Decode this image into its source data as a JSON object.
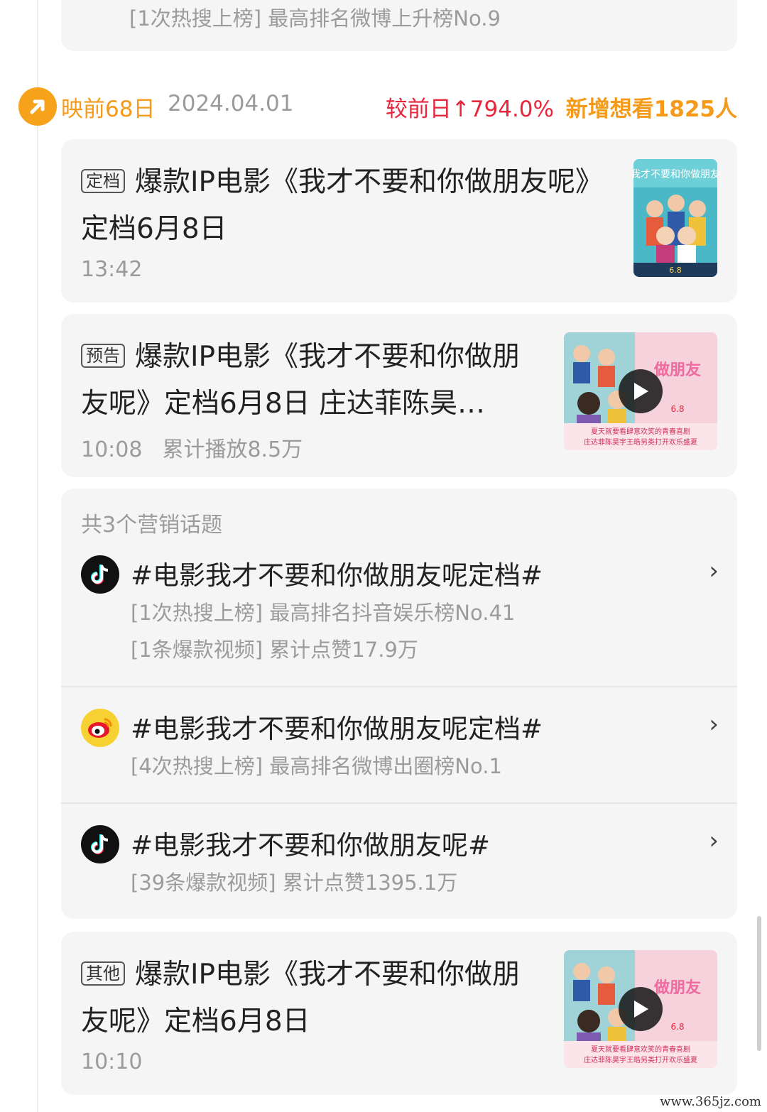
{
  "top_card": {
    "line": "[1次热搜上榜] 最高排名微博上升榜No.9"
  },
  "day": {
    "icon": "trend-arrow-icon",
    "label": "映前68日",
    "date": "2024.04.01",
    "change": "较前日↑794.0%",
    "added": "新增想看1825人"
  },
  "news": [
    {
      "tag": "定档",
      "title": "爆款IP电影《我才不要和你做朋友呢》定档6月8日",
      "time": "13:42",
      "stat": "",
      "thumb_type": "poster"
    },
    {
      "tag": "预告",
      "title": "爆款IP电影《我才不要和你做朋友呢》定档6月8日 庄达菲陈昊…",
      "time": "10:08",
      "stat": "累计播放8.5万",
      "thumb_type": "video"
    },
    {
      "tag": "其他",
      "title": "爆款IP电影《我才不要和你做朋友呢》定档6月8日",
      "time": "10:10",
      "stat": "",
      "thumb_type": "video"
    }
  ],
  "topics": {
    "header": "共3个营销话题",
    "items": [
      {
        "platform": "tiktok-icon",
        "title": "#电影我才不要和你做朋友呢定档#",
        "lines": [
          "[1次热搜上榜] 最高排名抖音娱乐榜No.41",
          "[1条爆款视频] 累计点赞17.9万"
        ]
      },
      {
        "platform": "weibo-icon",
        "title": "#电影我才不要和你做朋友呢定档#",
        "lines": [
          "[4次热搜上榜] 最高排名微博出圈榜No.1"
        ]
      },
      {
        "platform": "tiktok-icon",
        "title": "#电影我才不要和你做朋友呢#",
        "lines": [
          "[39条爆款视频] 累计点赞1395.1万"
        ]
      }
    ]
  },
  "poster_text": {
    "title": "我才不要和你做朋友",
    "date": "6.8",
    "tagline": "夏天就要看肆意欢笑的青春喜剧",
    "tagline2": "庄达菲陈昊宇王皓另类打开欢乐盛夏"
  },
  "watermark": "www.365jz.com",
  "colors": {
    "accent_orange": "#f59a1b",
    "up_red": "#e8263b",
    "card_bg": "#f5f5f5",
    "muted": "#9b9b9b"
  }
}
